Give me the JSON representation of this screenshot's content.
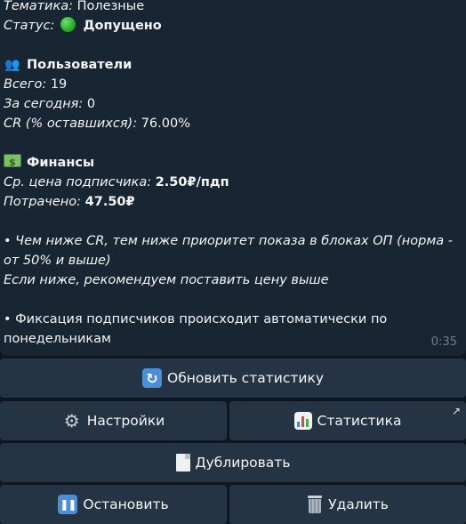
{
  "message": {
    "topic_label": "Тематика:",
    "topic_value": "Полезные",
    "status_label": "Статус:",
    "status_value": "Допущено",
    "users_emoji": "👥",
    "users_title": "Пользователи",
    "total_label": "Всего:",
    "total_value": "19",
    "today_label": "За сегодня:",
    "today_value": "0",
    "cr_label": "CR (% оставшихся):",
    "cr_value": "76.00%",
    "finance_title": "Финансы",
    "avg_price_label": "Ср. цена подписчика:",
    "avg_price_value": "2.50₽/пдп",
    "spent_label": "Потрачено:",
    "spent_value": "47.50₽",
    "note1_line1": "• Чем ниже CR, тем ниже приоритет показа в блоках ОП (норма -",
    "note1_line2": "от 50% и выше)",
    "note1_line3": "Если ниже, рекомендуем поставить цену выше",
    "note2_line1": "• Фиксация подписчиков происходит автоматически по",
    "note2_line2": "понедельникам",
    "time": "0:35"
  },
  "buttons": {
    "refresh": "Обновить статистику",
    "settings": "Настройки",
    "statistics": "Статистика",
    "duplicate": "Дублировать",
    "stop": "Остановить",
    "delete": "Удалить",
    "statistics_arrow": "↗"
  },
  "colors": {
    "background": "#0e1621",
    "bubble": "#182533",
    "button": "#253444",
    "status_green": "#1ea01e"
  }
}
